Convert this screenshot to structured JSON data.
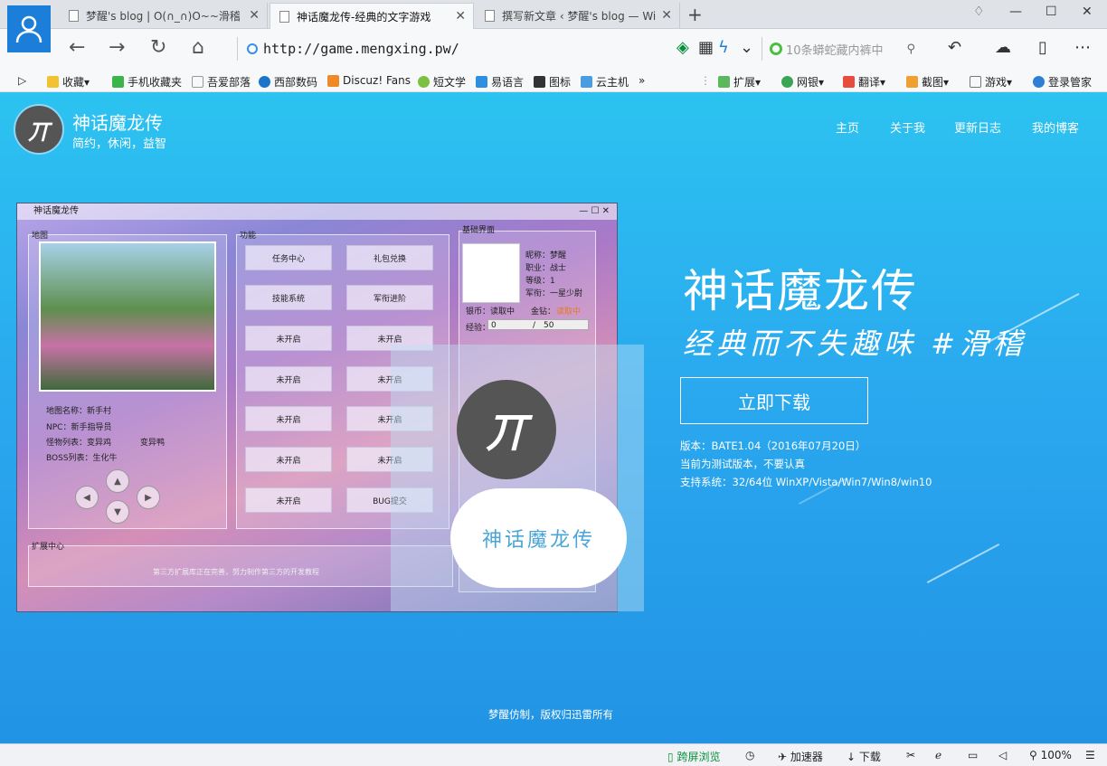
{
  "browser": {
    "tabs": [
      {
        "title": "梦醒's blog | O(∩_∩)O~~滑稽"
      },
      {
        "title": "神话魔龙传-经典的文字游戏"
      },
      {
        "title": "撰写新文章 ‹ 梦醒's blog — Wi"
      }
    ],
    "url": "http://game.mengxing.pw/",
    "search_placeholder": "10条蟒蛇藏内裤中",
    "favorites_left": [
      "收藏",
      "手机收藏夹",
      "吾爱部落",
      "西部数码",
      "Discuz! Fans",
      "短文学",
      "易语言",
      "图标",
      "云主机"
    ],
    "favorites_right": [
      "扩展",
      "网银",
      "翻译",
      "截图",
      "游戏",
      "登录管家"
    ],
    "status": {
      "cross_browse": "跨屏浏览",
      "accelerator": "加速器",
      "download": "下载",
      "zoom": "100%"
    }
  },
  "site": {
    "logo_text": "丌",
    "name": "神话魔龙传",
    "slogan": "简约，休闲，益智",
    "menu": [
      "主页",
      "关于我",
      "更新日志",
      "我的博客"
    ],
    "hero_title": "神话魔龙传",
    "hero_subtitle": "经典而不失趣味 #滑稽",
    "download_label": "立即下载",
    "version": "版本：BATE1.04（2016年07月20日）",
    "notice": "当前为测试版本，不要认真",
    "systems": "支持系统：32/64位 WinXP/Vista/Win7/Win8/win10",
    "footer": "梦醒仿制，版权归迅雷所有",
    "cloud_text": "神话魔龙传"
  },
  "game": {
    "window_title": "神话魔龙传",
    "map_label": "地图",
    "func_label": "功能",
    "basic_label": "基础界面",
    "expand_label": "扩展中心",
    "expand_msg": "第三方扩展库正在完善，努力制作第三方的开发教程",
    "map_info": [
      "地图名称：新手村",
      "NPC：新手指导员",
      "怪物列表：变异鸡",
      "BOSS列表：生化牛"
    ],
    "map_extra": "变异鸭",
    "buttons": [
      "任务中心",
      "礼包兑换",
      "技能系统",
      "军衔进阶",
      "未开启",
      "未开启",
      "未开启",
      "未开启",
      "未开启",
      "未开启",
      "未开启",
      "未开启",
      "未开启",
      "BUG提交"
    ],
    "profile": [
      "昵称：梦醒",
      "职业：战士",
      "等级：1",
      "军衔：一星少尉"
    ],
    "money": "银币：读取中",
    "gold": "金钻：",
    "gold_status": "读取中",
    "exp_label": "经验：",
    "exp_value": "0",
    "exp_sep": "/",
    "exp_max": "50"
  },
  "colors": {
    "accent": "#2aa9ef",
    "status_green": "#0a8f3d"
  }
}
